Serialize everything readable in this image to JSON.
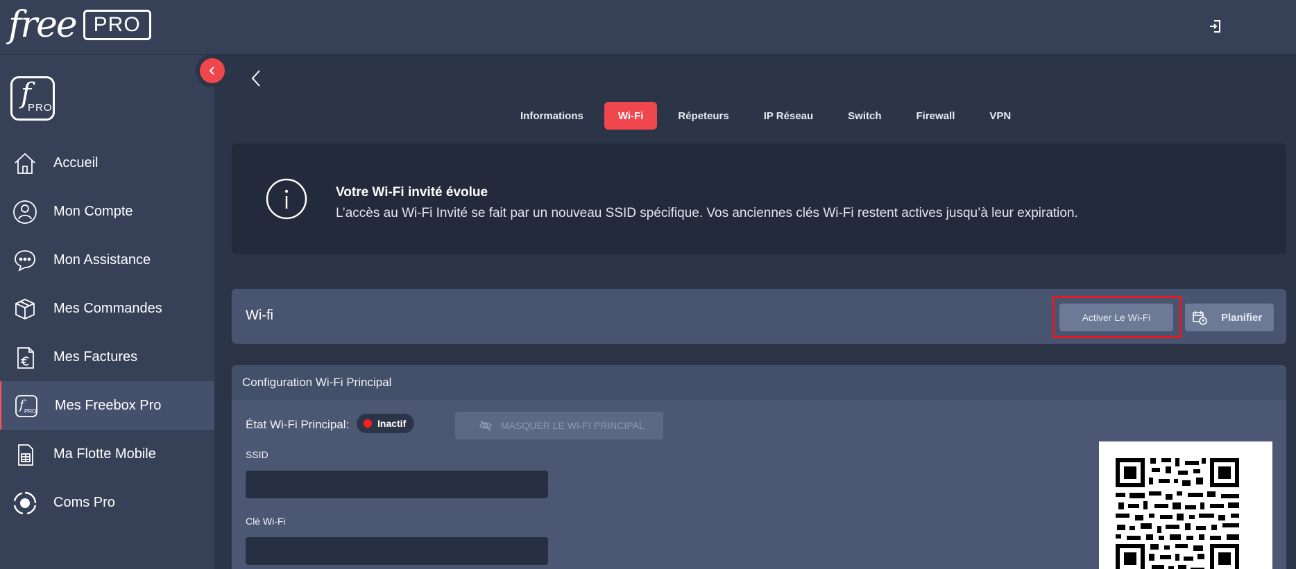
{
  "header": {
    "logo_free": "free",
    "logo_pro": "PRO",
    "logout_icon": "logout-icon"
  },
  "sidebar": {
    "logo_f": "f",
    "logo_pro": "PRO",
    "items": [
      {
        "label": "Accueil",
        "icon": "home-icon"
      },
      {
        "label": "Mon Compte",
        "icon": "user-icon"
      },
      {
        "label": "Mon Assistance",
        "icon": "chat-icon"
      },
      {
        "label": "Mes Commandes",
        "icon": "box-icon"
      },
      {
        "label": "Mes Factures",
        "icon": "invoice-icon"
      },
      {
        "label": "Mes Freebox Pro",
        "icon": "freebox-icon",
        "active": true
      },
      {
        "label": "Ma Flotte Mobile",
        "icon": "sim-icon"
      },
      {
        "label": "Coms Pro",
        "icon": "coms-icon"
      }
    ]
  },
  "tabs": [
    {
      "label": "Informations"
    },
    {
      "label": "Wi-Fi",
      "active": true
    },
    {
      "label": "Répeteurs"
    },
    {
      "label": "IP Réseau"
    },
    {
      "label": "Switch"
    },
    {
      "label": "Firewall"
    },
    {
      "label": "VPN"
    }
  ],
  "info": {
    "title": "Votre Wi-Fi invité évolue",
    "text": "L’accès au Wi-Fi Invité se fait par un nouveau SSID spécifique. Vos anciennes clés Wi-Fi restent actives jusqu’à leur expiration."
  },
  "wifi_bar": {
    "title": "Wi-fi",
    "activate_label": "Activer Le Wi-Fi",
    "schedule_label": "Planifier"
  },
  "config": {
    "title": "Configuration Wi-Fi Principal",
    "status_label": "État Wi-Fi Principal:",
    "status_value": "Inactif",
    "status_color": "#ff1e1e",
    "hide_label": "MASQUER LE WI-FI PRINCIPAL",
    "ssid_label": "SSID",
    "ssid_value": "",
    "key_label": "Clé Wi-Fi",
    "key_value": ""
  },
  "colors": {
    "accent": "#f0474e",
    "highlight": "#e11b22",
    "background": "#2c3547",
    "sidebar": "#364056"
  }
}
